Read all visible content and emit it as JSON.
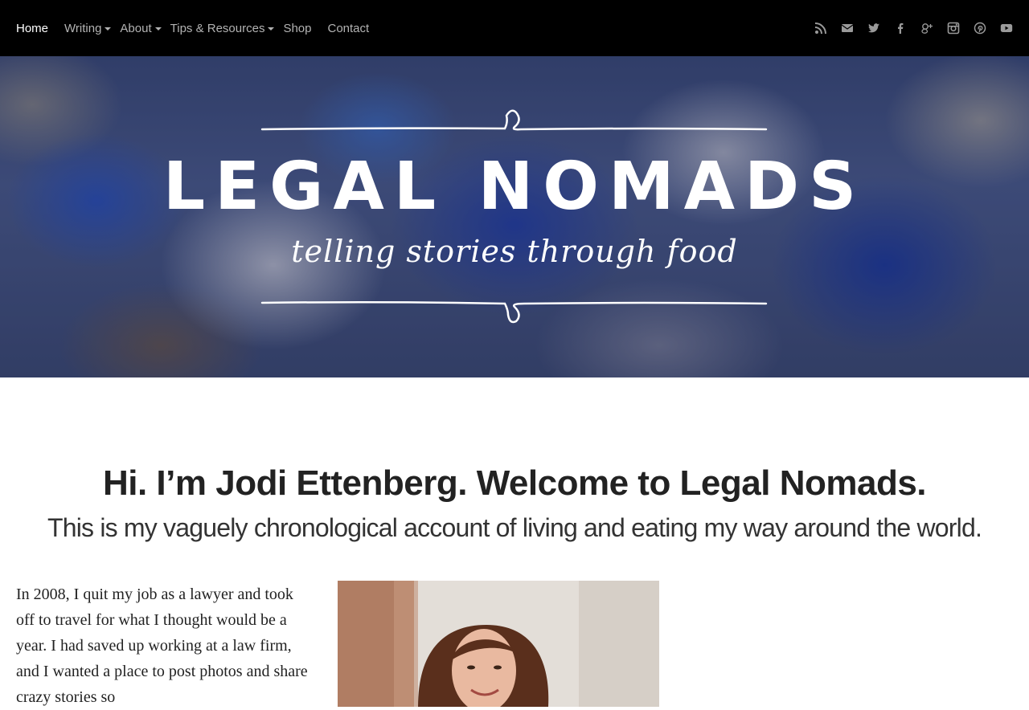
{
  "nav": {
    "items": [
      {
        "label": "Home",
        "active": true,
        "dropdown": false
      },
      {
        "label": "Writing",
        "active": false,
        "dropdown": true
      },
      {
        "label": "About",
        "active": false,
        "dropdown": true
      },
      {
        "label": "Tips & Resources",
        "active": false,
        "dropdown": true
      },
      {
        "label": "Shop",
        "active": false,
        "dropdown": false
      },
      {
        "label": "Contact",
        "active": false,
        "dropdown": false
      }
    ],
    "social_icons": [
      "rss-icon",
      "envelope-icon",
      "twitter-icon",
      "facebook-icon",
      "google-plus-icon",
      "instagram-icon",
      "pinterest-icon",
      "youtube-icon"
    ]
  },
  "hero": {
    "title": "LEGAL NOMADS",
    "tagline": "telling stories through food"
  },
  "main": {
    "headline": "Hi. I’m Jodi Ettenberg. Welcome to Legal Nomads.",
    "subheadline": "This is my vaguely chronological account of living and eating my way around the world.",
    "intro": "In 2008, I quit my job as a lawyer and took off to travel for what I thought would be a year. I had saved up working at a law firm, and I wanted a place to post photos and share crazy stories so"
  },
  "colors": {
    "nav_bg": "#000000",
    "nav_active": "#ffffff",
    "nav_inactive": "#b3b3b3",
    "text": "#222222"
  }
}
